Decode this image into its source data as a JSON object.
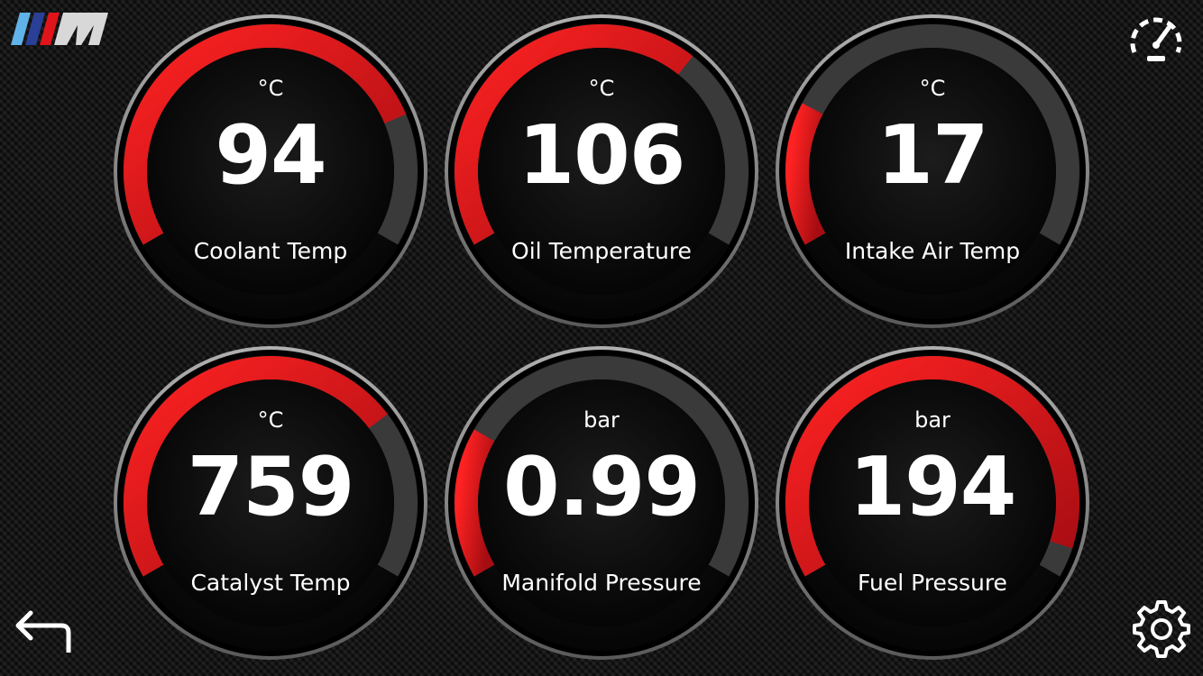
{
  "header": {
    "logo_icon": "m-logo-icon",
    "dashboard_icon": "speedometer-icon"
  },
  "footer": {
    "back_icon": "back-arrow-icon",
    "settings_icon": "gear-icon"
  },
  "colors": {
    "accent": "#e0141a",
    "track": "#3a3a3a",
    "ring": "#8a8a8a"
  },
  "gauges": [
    {
      "id": "coolant-temp",
      "unit": "°C",
      "value": "94",
      "label": "Coolant Temp",
      "level": 0.78
    },
    {
      "id": "oil-temperature",
      "unit": "°C",
      "value": "106",
      "label": "Oil Temperature",
      "level": 0.66
    },
    {
      "id": "intake-air-temp",
      "unit": "°C",
      "value": "17",
      "label": "Intake Air Temp",
      "level": 0.24
    },
    {
      "id": "catalyst-temp",
      "unit": "°C",
      "value": "759",
      "label": "Catalyst Temp",
      "level": 0.72
    },
    {
      "id": "manifold-pressure",
      "unit": "bar",
      "value": "0.99",
      "label": "Manifold Pressure",
      "level": 0.25
    },
    {
      "id": "fuel-pressure",
      "unit": "bar",
      "value": "194",
      "label": "Fuel Pressure",
      "level": 0.95
    }
  ]
}
